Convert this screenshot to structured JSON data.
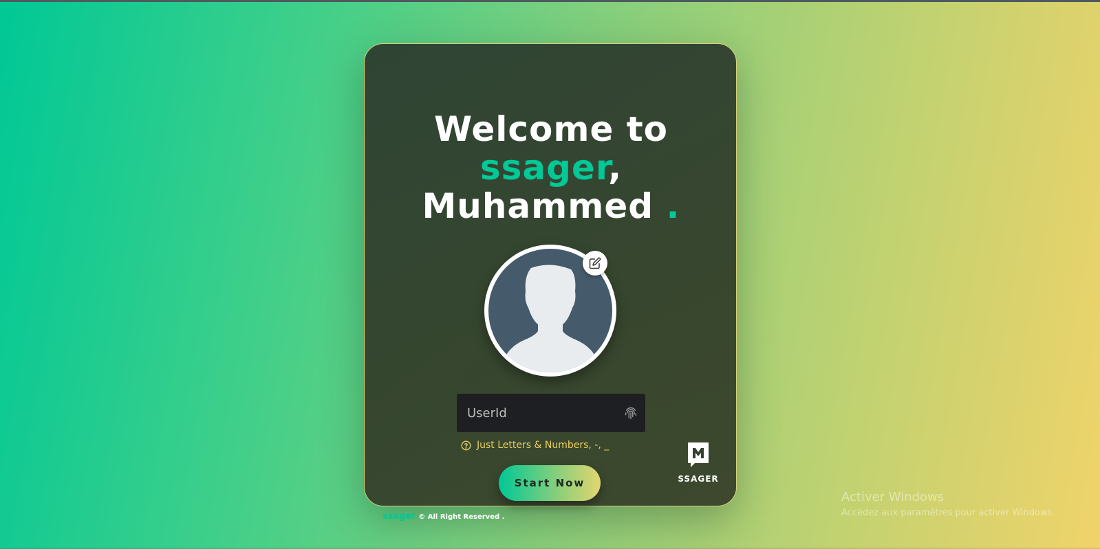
{
  "app": {
    "title_line1": "Welcome to",
    "title_brand": "ssager",
    "title_comma": ",",
    "title_name": "Muhammed",
    "title_dot": "."
  },
  "avatar": {
    "icon": "user-silhouette-icon",
    "edit_icon": "edit-icon"
  },
  "form": {
    "userid_placeholder": "UserId",
    "userid_value": "",
    "input_icon": "fingerprint-icon",
    "hint_icon": "question-circle-icon",
    "hint_text": "Just Letters & Numbers, -, _",
    "start_label": "Start Now"
  },
  "brand": {
    "logo_icon": "m-logo-icon",
    "name": "SSAGER"
  },
  "footer": {
    "brand": "ssager",
    "copyright": "© All Right Reserved ."
  },
  "watermark": {
    "line1": "Activer Windows",
    "line2": "Accédez aux paramètres pour activer Windows."
  },
  "colors": {
    "accent": "#00c896",
    "hint": "#e9cf5c",
    "card_bg": "#34422f",
    "input_bg": "#1e1f22",
    "avatar_bg": "#455a6b"
  }
}
